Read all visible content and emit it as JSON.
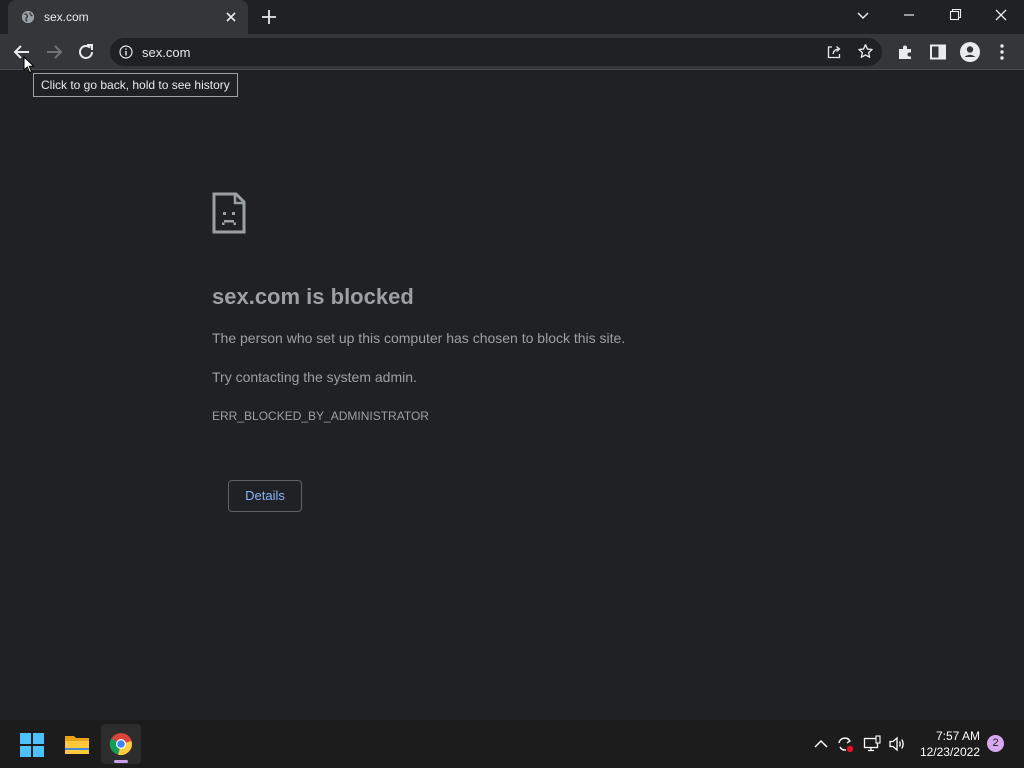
{
  "browser": {
    "tab": {
      "title": "sex.com",
      "favicon": "globe-icon"
    },
    "address_bar": {
      "url": "sex.com"
    },
    "tooltip": "Click to go back, hold to see history"
  },
  "error_page": {
    "title": "sex.com is blocked",
    "line1": "The person who set up this computer has chosen to block this site.",
    "line2": "Try contacting the system admin.",
    "error_code": "ERR_BLOCKED_BY_ADMINISTRATOR",
    "details_button": "Details"
  },
  "taskbar": {
    "apps": [
      "start-icon",
      "file-explorer-icon",
      "chrome-icon"
    ],
    "tray": [
      "chevron-up-icon",
      "sync-icon",
      "network-icon",
      "volume-icon"
    ],
    "time": "7:57 AM",
    "date": "12/23/2022",
    "notification_count": "2"
  },
  "colors": {
    "page_bg": "#202124",
    "toolbar_bg": "#35363a",
    "link_blue": "#8ab4f8",
    "muted_text": "#9aa0a6"
  }
}
